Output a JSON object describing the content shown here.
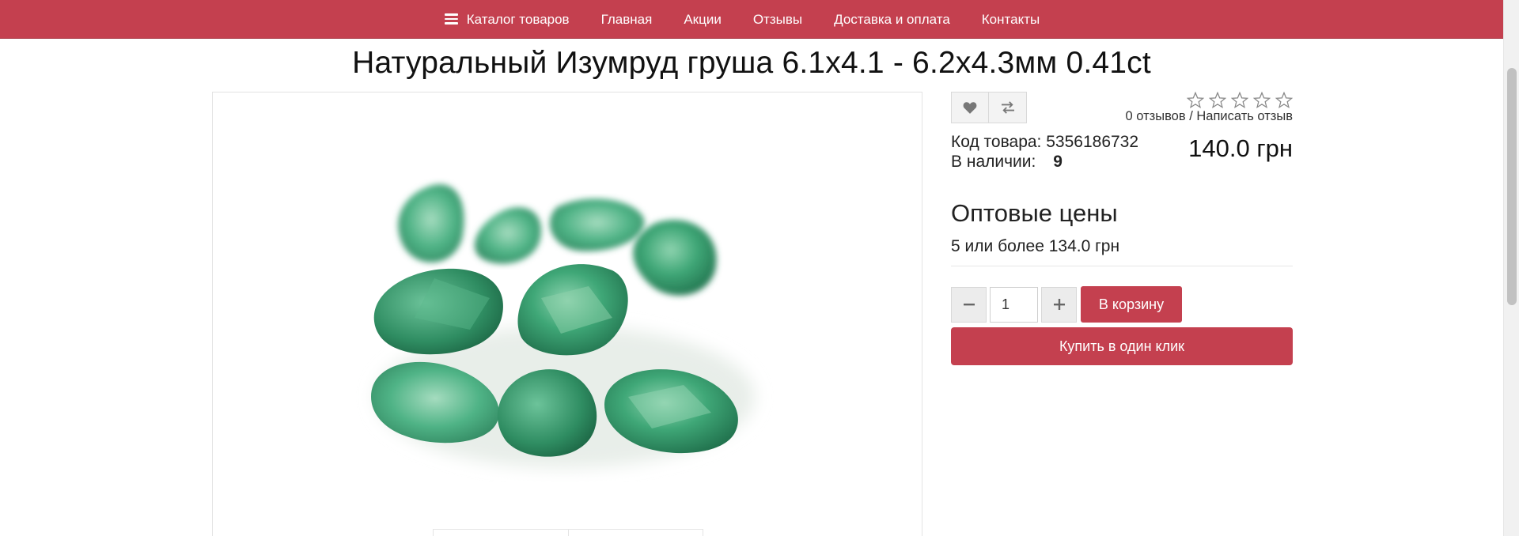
{
  "nav": {
    "items": [
      {
        "label": "Каталог товаров",
        "icon": "hamburger-icon"
      },
      {
        "label": "Главная"
      },
      {
        "label": "Акции"
      },
      {
        "label": "Отзывы"
      },
      {
        "label": "Доставка и оплата"
      },
      {
        "label": "Контакты"
      }
    ]
  },
  "product": {
    "title": "Натуральный Изумруд груша 6.1x4.1 - 6.2x4.3мм 0.41ct",
    "rating_stars": 0,
    "rating_max": 5,
    "reviews_label": "0 отзывов",
    "reviews_separator": " / ",
    "write_review_label": "Написать отзыв",
    "code_label": "Код товара:",
    "code_value": "5356186732",
    "stock_label": "В наличии:",
    "stock_value": "9",
    "price": "140.0 грн",
    "wholesale_title": "Оптовые цены",
    "wholesale_line": "5 или более 134.0 грн",
    "quantity": "1",
    "add_to_cart_label": "В корзину",
    "buy_one_click_label": "Купить в один клик"
  },
  "icons": {
    "wishlist": "heart-icon",
    "compare": "compare-arrows-icon",
    "minus": "minus-icon",
    "plus": "plus-icon"
  },
  "colors": {
    "brand": "#c4404f",
    "emerald": "#2e9a6a"
  }
}
